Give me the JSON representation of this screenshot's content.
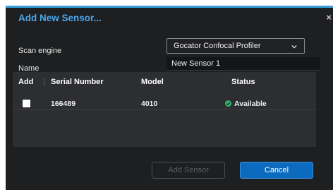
{
  "dialog": {
    "title": "Add New Sensor...",
    "close_glyph": "×"
  },
  "form": {
    "scan_engine_label": "Scan engine",
    "scan_engine_value": "Gocator Confocal Profiler",
    "name_label": "Name",
    "name_value": "New Sensor 1"
  },
  "table": {
    "columns": [
      "Add",
      "Serial Number",
      "Model",
      "Status"
    ],
    "rows": [
      {
        "add": false,
        "serial": "166489",
        "model": "4010",
        "status": "Available"
      }
    ]
  },
  "buttons": {
    "add_sensor": "Add Sensor",
    "cancel": "Cancel"
  },
  "colors": {
    "accent": "#4ba6ea",
    "background": "#1e1f21",
    "table_bg": "#2d2e31",
    "status_ok": "#2fb86a",
    "primary_button": "#0c6bbf"
  }
}
